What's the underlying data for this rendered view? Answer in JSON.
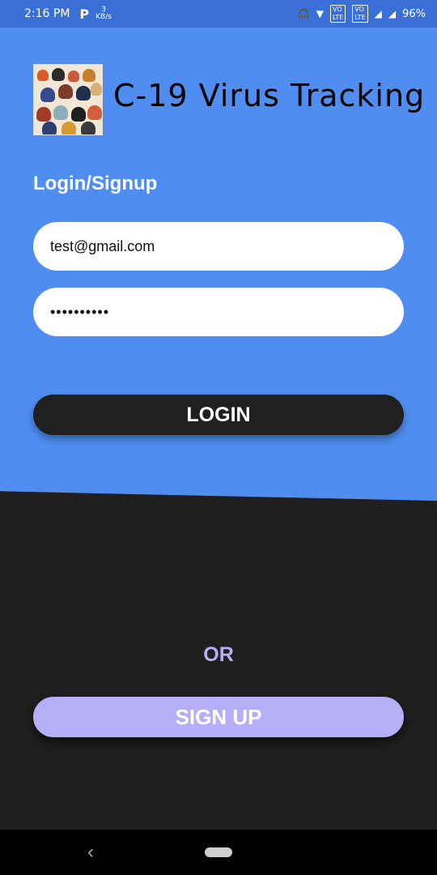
{
  "status_bar": {
    "time": "2:16 PM",
    "p_label": "P",
    "kb_value": "3",
    "kb_unit": "KB/s",
    "signal_label_1": "VO",
    "lte_label_1": "LTE",
    "signal_label_2": "VO",
    "lte_label_2": "LTE",
    "battery": "96%",
    "colors": {
      "bar": "#3a6fd8"
    }
  },
  "app": {
    "title": "C-19 Virus Tracking",
    "section_label": "Login/Signup"
  },
  "form": {
    "email_value": "test@gmail.com",
    "password_value": "••••••••••"
  },
  "buttons": {
    "login_label": "LOGIN",
    "or_label": "OR",
    "signup_label": "SIGN UP"
  },
  "nav": {
    "back_icon": "chevron-left",
    "home_icon": "pill-home"
  },
  "colors": {
    "primary_blue": "#4f8ef0",
    "dark": "#1f1f1f",
    "accent_purple": "#b6aef7",
    "white": "#ffffff"
  }
}
